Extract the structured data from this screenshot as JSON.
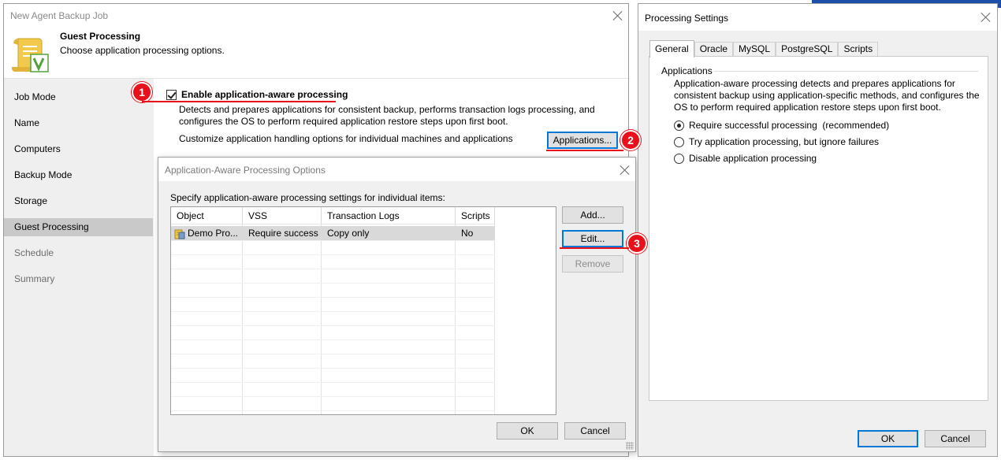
{
  "wizard": {
    "title": "New Agent Backup Job",
    "header_title": "Guest Processing",
    "header_subtitle": "Choose application processing options.",
    "icon": "document-check-icon",
    "nav": [
      {
        "label": "Job Mode",
        "state": "normal"
      },
      {
        "label": "Name",
        "state": "normal"
      },
      {
        "label": "Computers",
        "state": "normal"
      },
      {
        "label": "Backup Mode",
        "state": "normal"
      },
      {
        "label": "Storage",
        "state": "normal"
      },
      {
        "label": "Guest Processing",
        "state": "active"
      },
      {
        "label": "Schedule",
        "state": "disabled"
      },
      {
        "label": "Summary",
        "state": "disabled"
      }
    ],
    "enable_label": "Enable application-aware processing",
    "enable_checked": true,
    "description": "Detects and prepares applications for consistent backup, performs transaction logs processing, and configures the OS to perform required application restore steps upon first boot.",
    "customize_text": "Customize application handling options for individual machines and applications",
    "applications_button": "Applications..."
  },
  "aao_dialog": {
    "title": "Application-Aware Processing Options",
    "prompt": "Specify application-aware processing settings for individual items:",
    "columns": [
      "Object",
      "VSS",
      "Transaction Logs",
      "Scripts"
    ],
    "rows": [
      {
        "object": "Demo Pro...",
        "vss": "Require success",
        "logs": "Copy only",
        "scripts": "No"
      }
    ],
    "buttons": {
      "add": "Add...",
      "edit": "Edit...",
      "remove": "Remove",
      "ok": "OK",
      "cancel": "Cancel"
    }
  },
  "processing_settings": {
    "title": "Processing Settings",
    "tabs": [
      "General",
      "Oracle",
      "MySQL",
      "PostgreSQL",
      "Scripts"
    ],
    "active_tab": "General",
    "group": "Applications",
    "description": "Application-aware processing detects and prepares applications for consistent backup using application-specific methods, and configures the OS to perform required application restore steps upon first boot.",
    "options": [
      {
        "label": "Require successful processing  (recommended)",
        "checked": true
      },
      {
        "label": "Try application processing, but ignore failures",
        "checked": false
      },
      {
        "label": "Disable application processing",
        "checked": false
      }
    ],
    "buttons": {
      "ok": "OK",
      "cancel": "Cancel"
    }
  },
  "callouts": [
    "1",
    "2",
    "3"
  ],
  "colors": {
    "callout": "#e8101a",
    "focus": "#0078d7",
    "selected_nav": "#c9c9c9"
  }
}
